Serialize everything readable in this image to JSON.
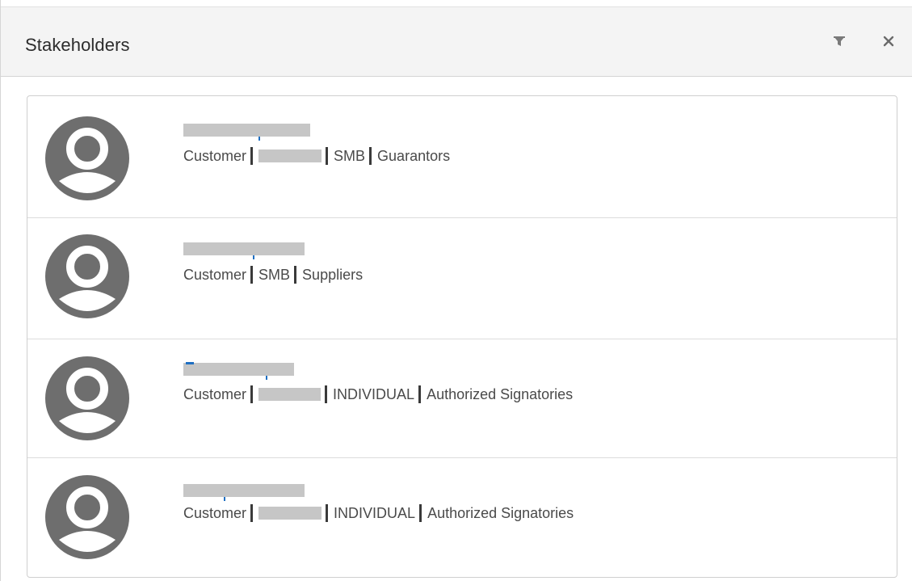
{
  "panel": {
    "title": "Stakeholders",
    "filter_icon": "filter-icon",
    "close_icon": "close-icon"
  },
  "stakeholders": [
    {
      "avatar_icon": "user-avatar-icon",
      "name": "",
      "meta_parts": [
        "Customer",
        "SMB",
        "Guarantors"
      ]
    },
    {
      "avatar_icon": "user-avatar-icon",
      "name": "",
      "meta_parts": [
        "Customer",
        "SMB",
        "Suppliers"
      ]
    },
    {
      "avatar_icon": "user-avatar-icon",
      "name": "",
      "meta_parts": [
        "Customer",
        "INDIVIDUAL",
        "Authorized Signatories"
      ]
    },
    {
      "avatar_icon": "user-avatar-icon",
      "name": "",
      "meta_parts": [
        "Customer",
        "INDIVIDUAL",
        "Authorized Signatories"
      ]
    }
  ],
  "colors": {
    "header_bg": "#f4f4f4",
    "avatar": "#6e6e6e",
    "redaction": "#c6c6c6",
    "name_link": "#1f6fc2"
  }
}
